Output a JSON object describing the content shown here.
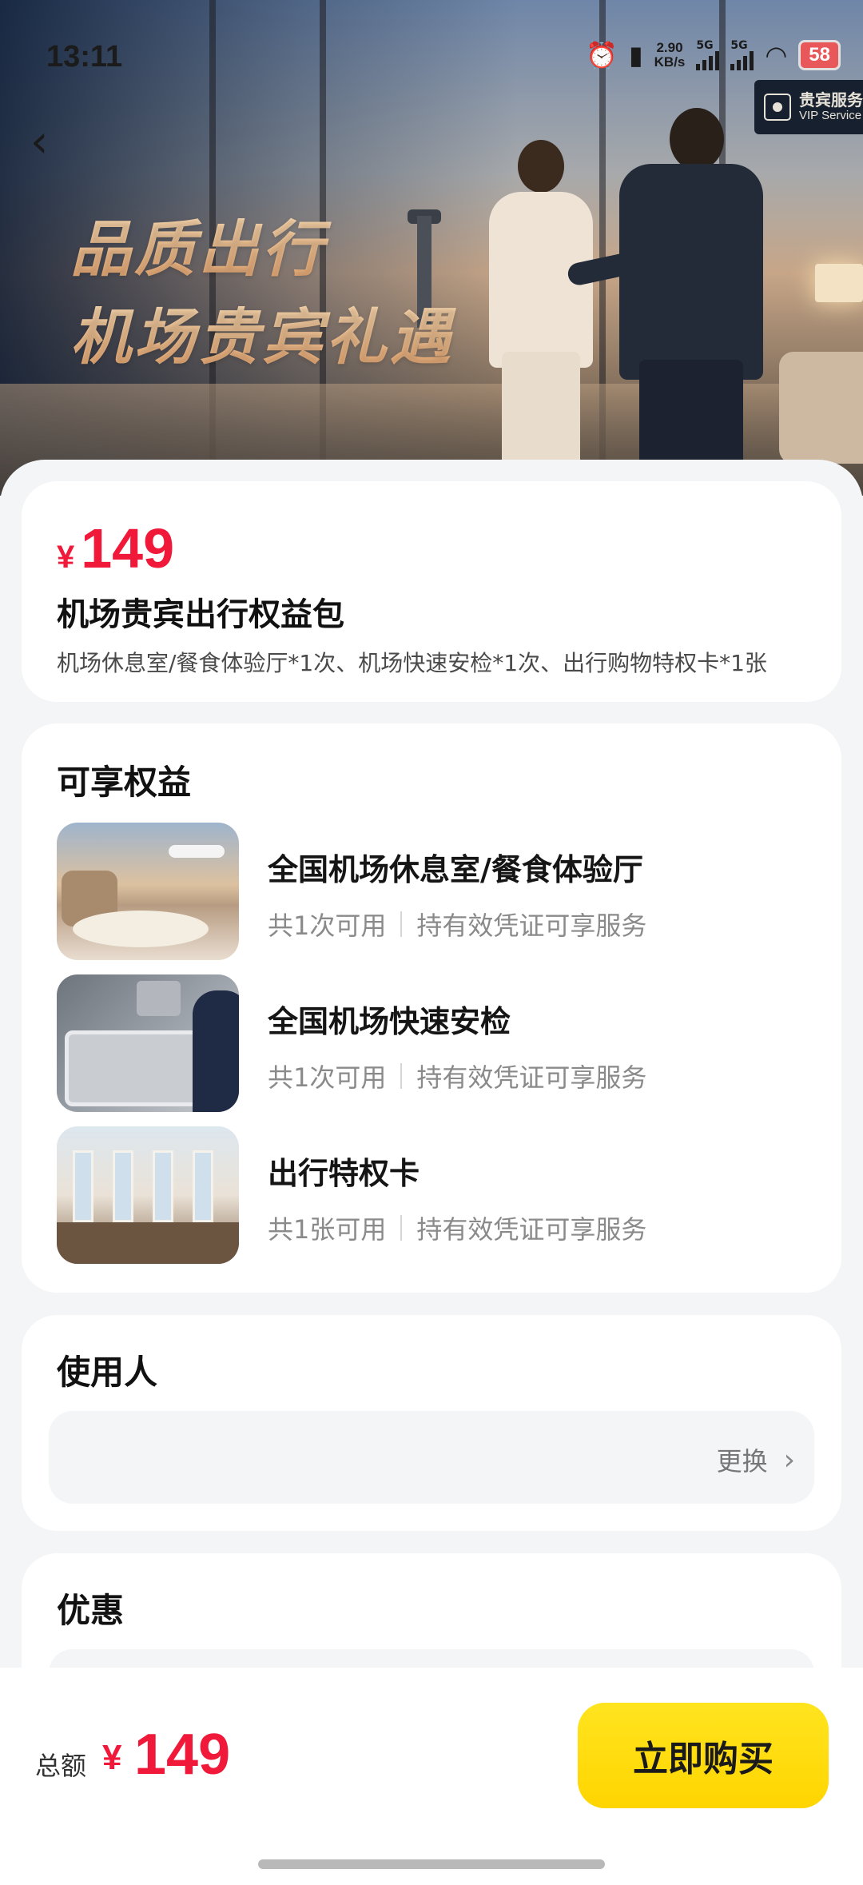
{
  "status_bar": {
    "time": "13:11",
    "net_speed": "2.90",
    "net_unit": "KB/s",
    "sig1_label": "5G",
    "sig2_label": "5G",
    "battery": "58",
    "icons": [
      "alarm-icon",
      "vibrate-icon",
      "wifi-icon"
    ]
  },
  "hero": {
    "title_line1": "品质出行",
    "title_line2": "机场贵宾礼遇",
    "sign_cn": "贵宾服务",
    "sign_en": "VIP Service"
  },
  "nav": {
    "back_icon": "‹"
  },
  "product": {
    "currency": "¥",
    "price": "149",
    "name": "机场贵宾出行权益包",
    "desc": "机场休息室/餐食体验厅*1次、机场快速安检*1次、出行购物特权卡*1张"
  },
  "benefits": {
    "title": "可享权益",
    "items": [
      {
        "title": "全国机场休息室/餐食体验厅",
        "count": "共1次可用",
        "note": "持有效凭证可享服务"
      },
      {
        "title": "全国机场快速安检",
        "count": "共1次可用",
        "note": "持有效凭证可享服务"
      },
      {
        "title": "出行特权卡",
        "count": "共1张可用",
        "note": "持有效凭证可享服务"
      }
    ]
  },
  "user": {
    "title": "使用人",
    "change_label": "更换",
    "chevron": "›"
  },
  "discount": {
    "title": "优惠"
  },
  "footer": {
    "total_label": "总额",
    "currency": "¥",
    "total": "149",
    "buy_label": "立即购买"
  },
  "colors": {
    "price_red": "#f0193a",
    "buy_yellow": "#ffdc10",
    "page_bg": "#f4f5f7"
  }
}
